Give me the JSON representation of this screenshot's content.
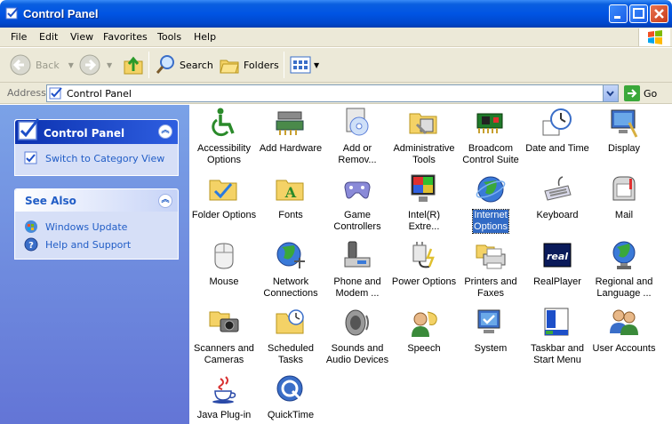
{
  "window": {
    "title": "Control Panel"
  },
  "menu": [
    "File",
    "Edit",
    "View",
    "Favorites",
    "Tools",
    "Help"
  ],
  "toolbar": {
    "back": "Back",
    "search": "Search",
    "folders": "Folders"
  },
  "address": {
    "label": "Address",
    "value": "Control Panel",
    "go": "Go"
  },
  "left": {
    "control_panel": {
      "title": "Control Panel",
      "link": "Switch to Category View"
    },
    "see_also": {
      "title": "See Also",
      "links": [
        "Windows Update",
        "Help and Support"
      ]
    }
  },
  "items": [
    {
      "l1": "Accessibility",
      "l2": "Options"
    },
    {
      "l1": "Add Hardware",
      "l2": ""
    },
    {
      "l1": "Add or",
      "l2": "Remov..."
    },
    {
      "l1": "Administrative",
      "l2": "Tools"
    },
    {
      "l1": "Broadcom",
      "l2": "Control Suite"
    },
    {
      "l1": "Date and Time",
      "l2": ""
    },
    {
      "l1": "Display",
      "l2": ""
    },
    {
      "l1": "Folder Options",
      "l2": ""
    },
    {
      "l1": "Fonts",
      "l2": ""
    },
    {
      "l1": "Game",
      "l2": "Controllers"
    },
    {
      "l1": "Intel(R)",
      "l2": "Extre..."
    },
    {
      "l1": "Internet",
      "l2": "Options"
    },
    {
      "l1": "Keyboard",
      "l2": ""
    },
    {
      "l1": "Mail",
      "l2": ""
    },
    {
      "l1": "Mouse",
      "l2": ""
    },
    {
      "l1": "Network",
      "l2": "Connections"
    },
    {
      "l1": "Phone and",
      "l2": "Modem ..."
    },
    {
      "l1": "Power Options",
      "l2": ""
    },
    {
      "l1": "Printers and",
      "l2": "Faxes"
    },
    {
      "l1": "RealPlayer",
      "l2": ""
    },
    {
      "l1": "Regional and",
      "l2": "Language ..."
    },
    {
      "l1": "Scanners and",
      "l2": "Cameras"
    },
    {
      "l1": "Scheduled",
      "l2": "Tasks"
    },
    {
      "l1": "Sounds and",
      "l2": "Audio Devices"
    },
    {
      "l1": "Speech",
      "l2": ""
    },
    {
      "l1": "System",
      "l2": ""
    },
    {
      "l1": "Taskbar and",
      "l2": "Start Menu"
    },
    {
      "l1": "User Accounts",
      "l2": ""
    },
    {
      "l1": "Java Plug-in",
      "l2": ""
    },
    {
      "l1": "QuickTime",
      "l2": ""
    }
  ],
  "colors": {
    "titlebar": "#0054e3",
    "leftpane": "#6375d6",
    "link": "#215dc6",
    "selection": "#316ac5"
  }
}
